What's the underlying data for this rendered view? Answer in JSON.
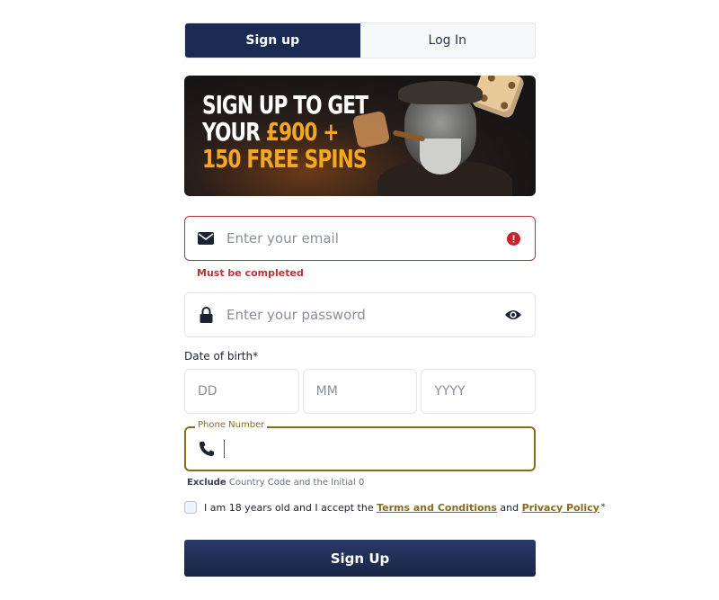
{
  "tabs": [
    {
      "label": "Sign up",
      "active": true
    },
    {
      "label": "Log In",
      "active": false
    }
  ],
  "banner": {
    "line1": "SIGN UP TO GET",
    "line2_prefix": "YOUR ",
    "line2_gold": "£900 +",
    "line3": "150 FREE SPINS"
  },
  "email": {
    "placeholder": "Enter your email",
    "error": "Must be completed"
  },
  "password": {
    "placeholder": "Enter your password"
  },
  "dob": {
    "label": "Date of birth*",
    "dd": "DD",
    "mm": "MM",
    "yyyy": "YYYY"
  },
  "phone": {
    "label": "Phone Number",
    "hint_bold": "Exclude",
    "hint_rest": " Country Code and the Initial 0"
  },
  "agree": {
    "prefix": "I am 18 years old and I accept the ",
    "terms": "Terms and Conditions",
    "middle": " and ",
    "privacy": "Privacy Policy",
    "required": "*"
  },
  "submit_label": "Sign Up",
  "colors": {
    "primary": "#1a2a52",
    "accent": "#8a6a1e",
    "error": "#b8333a"
  }
}
